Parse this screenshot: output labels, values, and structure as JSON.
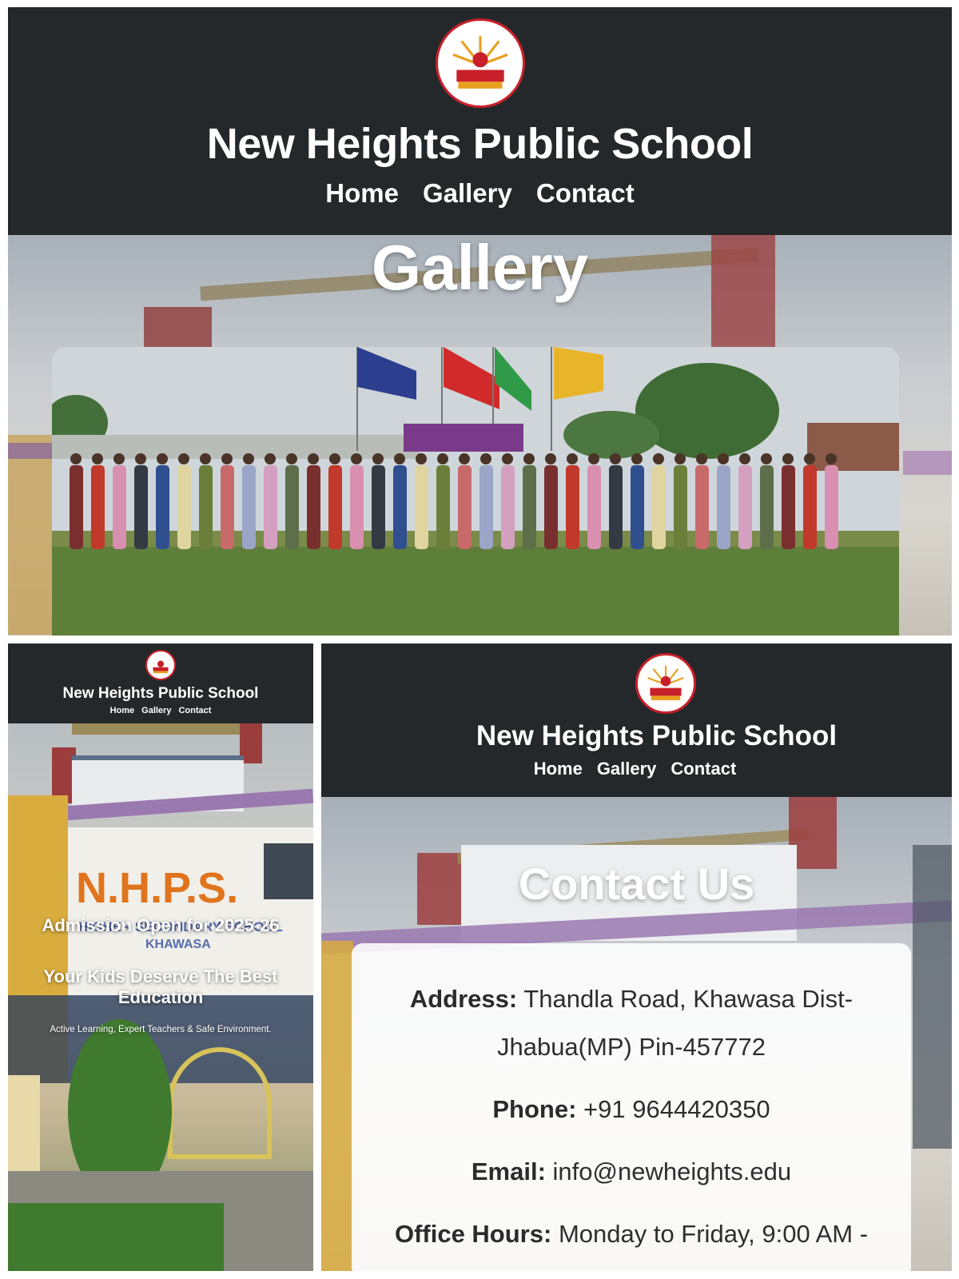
{
  "site": {
    "name": "New Heights Public School",
    "logo_text_top": "NEW HEIGHTS PUBLIC SCHOOL",
    "logo_text_band": "KHAWASA",
    "logo_icon": "school-crest-logo"
  },
  "nav": {
    "home": "Home",
    "gallery": "Gallery",
    "contact": "Contact"
  },
  "gallery_page": {
    "heading": "Gallery",
    "photo": "group-photo-staff-and-students"
  },
  "home_page": {
    "admission": "Admission Open for 2025-26",
    "tagline": "Your Kids Deserve The Best Education",
    "subtext": "Active Learning, Expert Teachers & Safe Environment.",
    "building_sign": "N.H.P.S.",
    "building_sign_line2": "HIGHER SECONDARY SCHOOL",
    "building_sign_line3": "KHAWASA"
  },
  "contact_page": {
    "heading": "Contact Us",
    "address_label": "Address:",
    "address_value": "Thandla Road, Khawasa Dist-Jhabua(MP) Pin-457772",
    "phone_label": "Phone:",
    "phone_value": "+91 9644420350",
    "email_label": "Email:",
    "email_value": "info@newheights.edu",
    "hours_label": "Office Hours:",
    "hours_value": "Monday to Friday, 9:00 AM -"
  },
  "colors": {
    "header_bg": "#25282b",
    "logo_red": "#c8202a",
    "text_white": "#ffffff"
  }
}
